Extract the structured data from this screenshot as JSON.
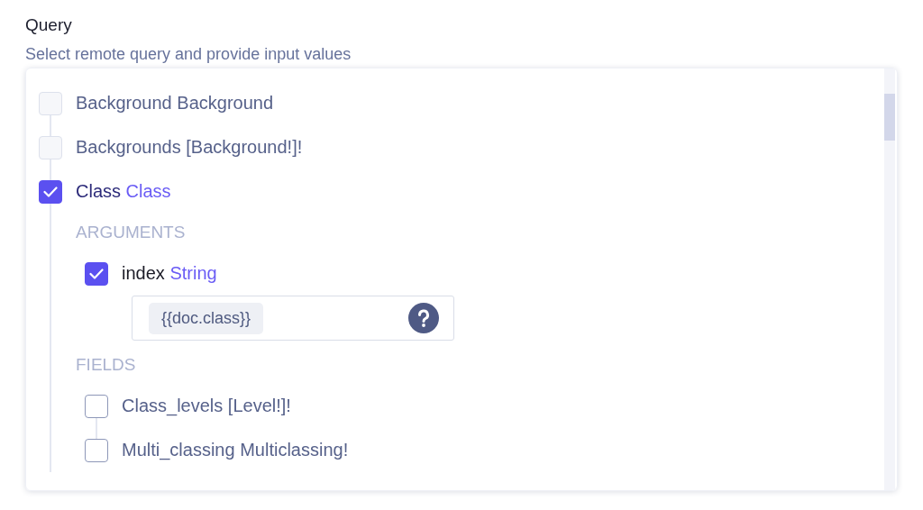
{
  "header": {
    "title": "Query",
    "subtitle": "Select remote query and provide input values"
  },
  "tree": [
    {
      "name": "Background",
      "type": "Background",
      "checked": false
    },
    {
      "name": "Backgrounds",
      "type": "[Background!]!",
      "checked": false
    },
    {
      "name": "Class",
      "type": "Class",
      "checked": true,
      "sections": [
        {
          "label": "ARGUMENTS",
          "children": [
            {
              "name": "index",
              "type": "String",
              "checked": true,
              "input": {
                "value": "{{doc.class}}"
              }
            }
          ]
        },
        {
          "label": "FIELDS",
          "children": [
            {
              "name": "Class_levels",
              "type": "[Level!]!",
              "checked": false
            },
            {
              "name": "Multi_classing",
              "type": "Multiclassing!",
              "checked": false
            }
          ]
        }
      ]
    }
  ]
}
